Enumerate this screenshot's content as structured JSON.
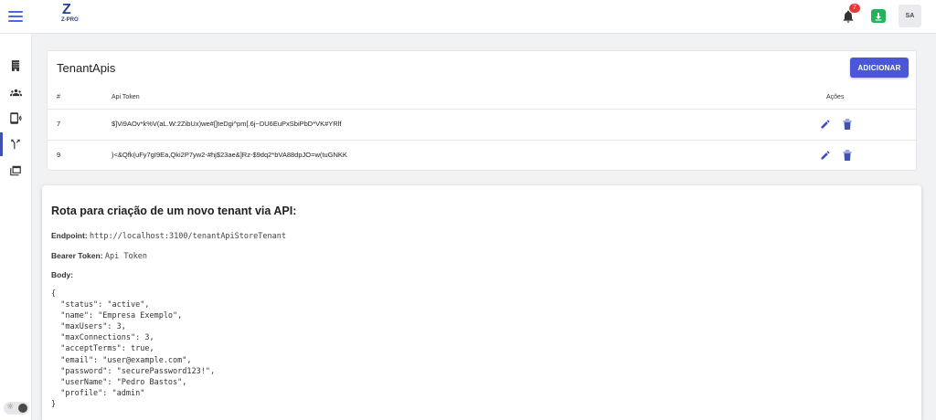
{
  "header": {
    "logo_text": "Z-PRO",
    "notifications_count": "7",
    "avatar_initials": "SA",
    "colors": {
      "accent": "#4b57d8",
      "badge": "#e53935",
      "download": "#21b45a"
    }
  },
  "sidebar": {
    "items": [
      {
        "icon": "building-icon",
        "active": false
      },
      {
        "icon": "users-icon",
        "active": false
      },
      {
        "icon": "phone-connect-icon",
        "active": false
      },
      {
        "icon": "api-fork-icon",
        "active": true
      },
      {
        "icon": "window-stack-icon",
        "active": false
      }
    ],
    "theme_toggle": "light"
  },
  "tenant_apis": {
    "title": "TenantApis",
    "add_button": "ADICIONAR",
    "columns": {
      "id": "#",
      "token": "Api Token",
      "actions": "Ações"
    },
    "rows": [
      {
        "id": "7",
        "token": "$]Vi9AOv*k%V(aL.W:2ZibUx)we#[]teDgi^pm[.6j~DU6EuPxSbiPbD*VK#YRlf"
      },
      {
        "id": "9",
        "token": ")<&Qfk(uFy7gI9Ea,Qki2P7yw2-#hj$23ae&]Rz-$9dq2*bVA88dpJO=w(tuGNKK"
      }
    ]
  },
  "api_info": {
    "title": "Rota para criação de um novo tenant via API:",
    "endpoint_label": "Endpoint:",
    "endpoint_value": "http://localhost:3100/tenantApiStoreTenant",
    "bearer_label": "Bearer Token:",
    "bearer_value": "Api Token",
    "body_label": "Body:",
    "body_json": "{\n  \"status\": \"active\",\n  \"name\": \"Empresa Exemplo\",\n  \"maxUsers\": 3,\n  \"maxConnections\": 3,\n  \"acceptTerms\": true,\n  \"email\": \"user@example.com\",\n  \"password\": \"securePassword123!\",\n  \"userName\": \"Pedro Bastos\",\n  \"profile\": \"admin\"\n}"
  }
}
